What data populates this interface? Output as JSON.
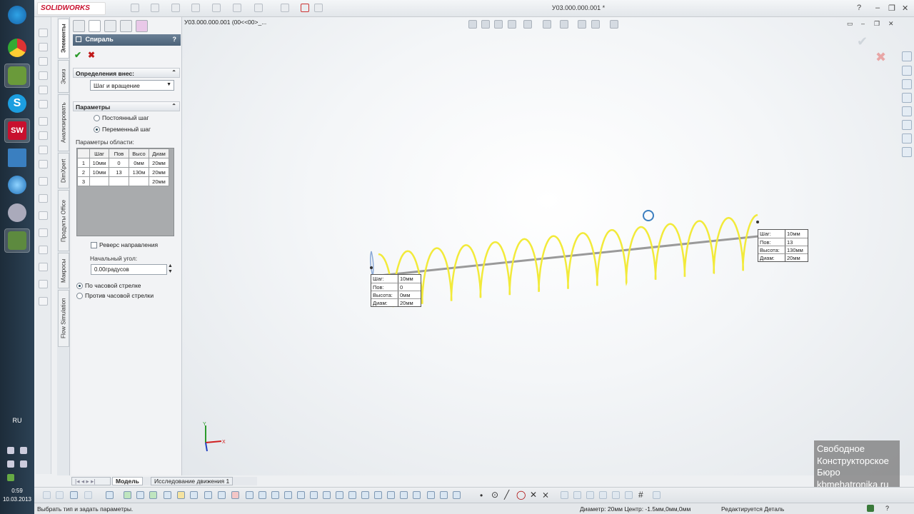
{
  "app": {
    "brand": "SOLIDWORKS",
    "doc_title": "У03.000.000.001 *"
  },
  "taskbar": {
    "lang": "RU",
    "time": "0:59",
    "date": "10.03.2013"
  },
  "tree": {
    "node": "У03.000.000.001  (00<<00>_..."
  },
  "vertical_tabs": [
    "Элементы",
    "Эскиз",
    "Анализировать",
    "DimXpert",
    "Продукты Office",
    "Макросы",
    "Flow Simulation"
  ],
  "pm": {
    "title": "Спираль",
    "help": "?",
    "ok": "✔",
    "cancel": "✖",
    "group_def": "Определения внес:",
    "def_select": "Шаг и вращение",
    "group_params": "Параметры",
    "radio_const": "Постоянный шаг",
    "radio_var": "Переменный шаг",
    "region_label": "Параметры области:",
    "table": {
      "headers": [
        "",
        "Шаг",
        "Пов",
        "Высо",
        "Диам"
      ],
      "rows": [
        [
          "1",
          "10мм",
          "0",
          "0мм",
          "20мм"
        ],
        [
          "2",
          "10мм",
          "13",
          "130м",
          "20мм"
        ],
        [
          "3",
          "",
          "",
          "",
          "20мм"
        ]
      ]
    },
    "reverse": "Реверс направления",
    "start_angle_label": "Начальный угол:",
    "start_angle_value": "0.00градусов",
    "cw": "По часовой стрелке",
    "ccw": "Против часовой стрелки"
  },
  "helix_tips": {
    "left": [
      [
        "Шаг:",
        "10мм"
      ],
      [
        "Пов:",
        "0"
      ],
      [
        "Высота:",
        "0мм"
      ],
      [
        "Диам:",
        "20мм"
      ]
    ],
    "right": [
      [
        "Шаг:",
        "10мм"
      ],
      [
        "Пов:",
        "13"
      ],
      [
        "Высота:",
        "130мм"
      ],
      [
        "Диам:",
        "20мм"
      ]
    ]
  },
  "triad": {
    "x": "X",
    "y": "Y"
  },
  "watermark": [
    "Свободное",
    "Конструкторское",
    "Бюро",
    "kbmehatronika.ru"
  ],
  "bottom_tabs": [
    "Модель",
    "Исследование движения 1"
  ],
  "status": {
    "left": "Выбрать тип и задать параметры.",
    "measure": "Диаметр: 20мм  Центр: -1.5мм,0мм,0мм",
    "mode": "Редактируется Деталь"
  },
  "colors": {
    "helix": "#f2ea3a",
    "axis": "#9a9a9a",
    "brand": "#c8102e"
  }
}
